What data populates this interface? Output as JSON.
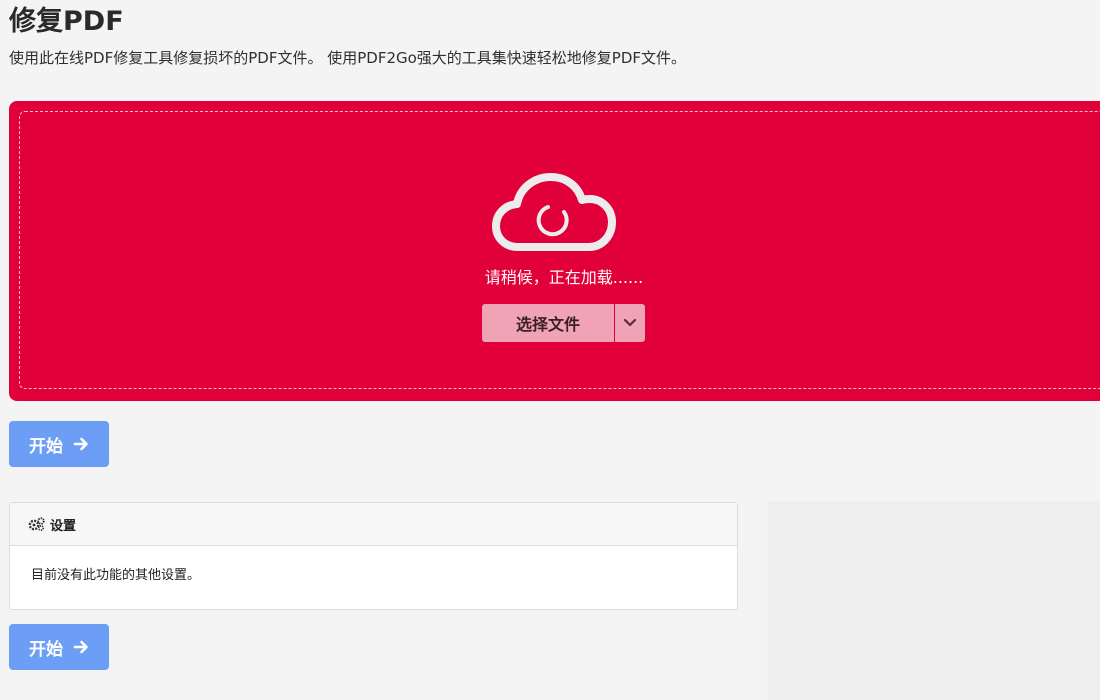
{
  "page": {
    "title": "修复PDF",
    "subtitle": "使用此在线PDF修复工具修复损坏的PDF文件。 使用PDF2Go强大的工具集快速轻松地修复PDF文件。"
  },
  "upload": {
    "icon": "cloud-loading-icon",
    "loading_text": "请稍候，正在加载......",
    "choose_label": "选择文件",
    "toggle_icon": "chevron-down-icon",
    "accent_color": "#e2003a"
  },
  "actions": {
    "start_label": "开始",
    "start_icon": "arrow-right-icon",
    "button_color": "#6d9ef5"
  },
  "settings": {
    "icon": "gears-icon",
    "title": "设置",
    "message": "目前没有此功能的其他设置。"
  }
}
